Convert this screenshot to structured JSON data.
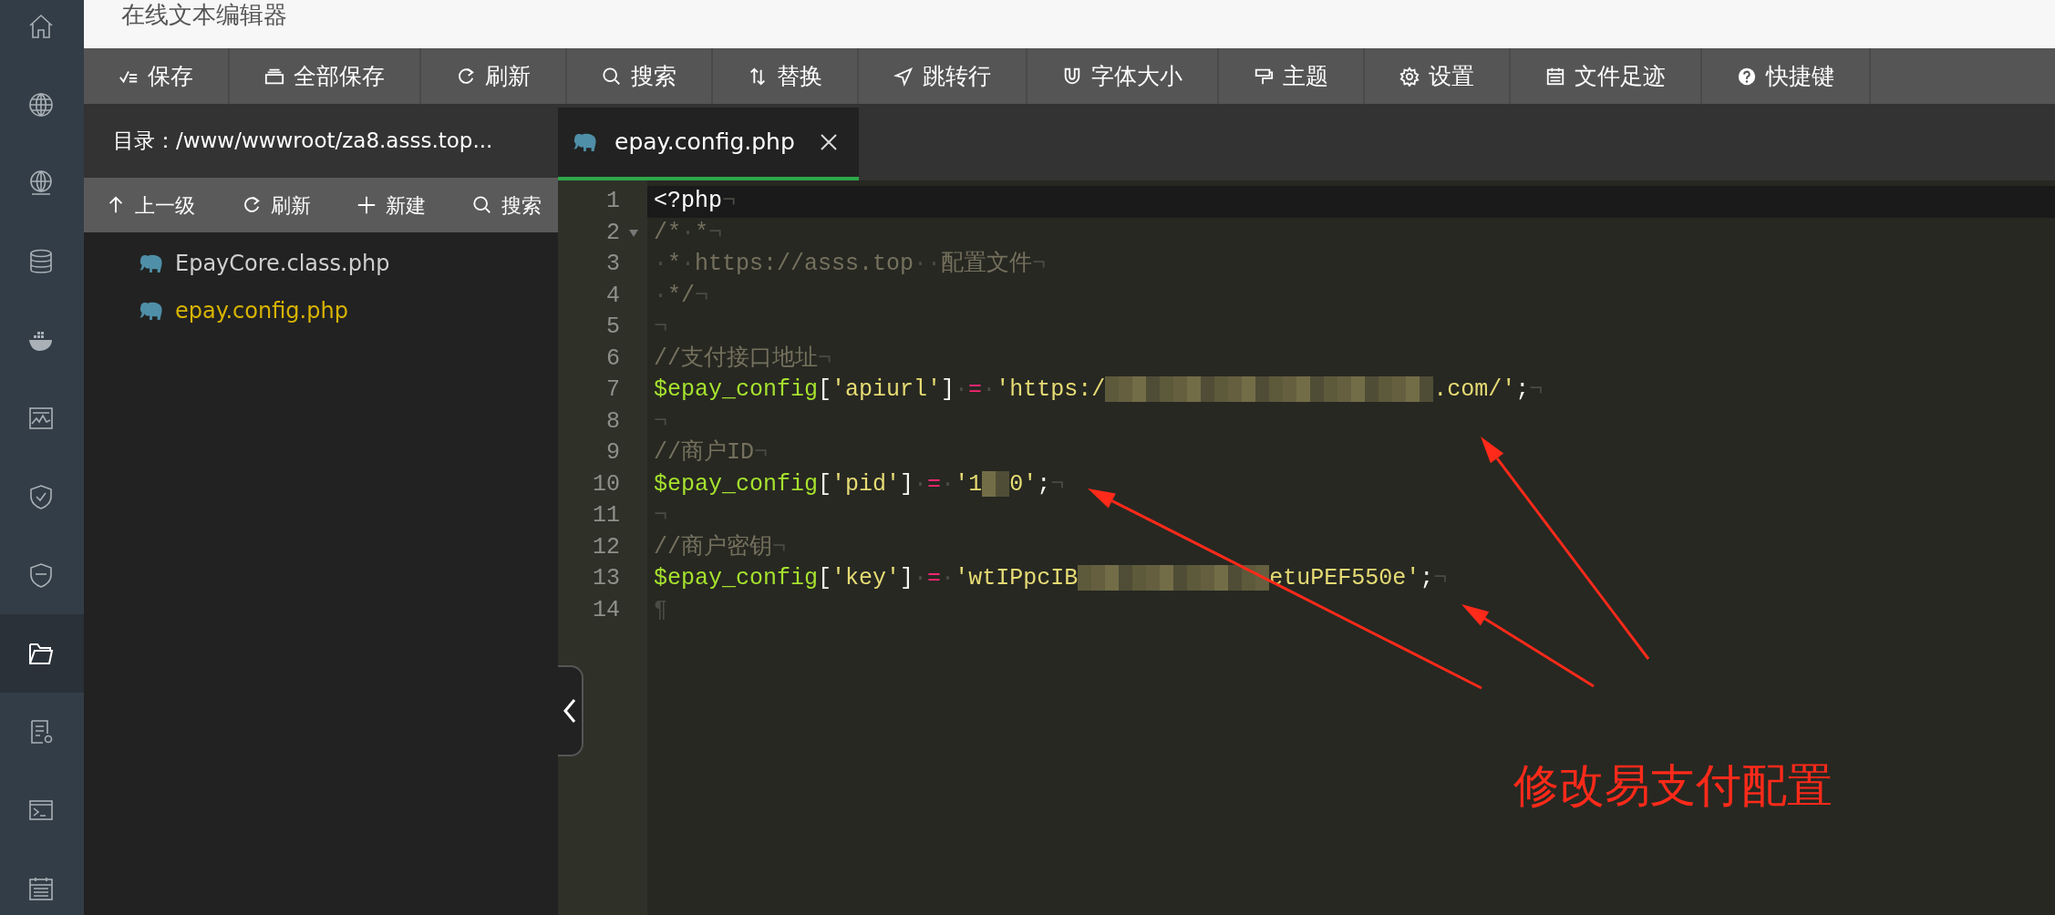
{
  "sidebar": {
    "items": [
      {
        "selected": false
      },
      {
        "selected": false
      },
      {
        "selected": false
      },
      {
        "selected": false
      },
      {
        "selected": false
      },
      {
        "selected": false
      },
      {
        "selected": false
      },
      {
        "selected": false
      },
      {
        "selected": true
      },
      {
        "selected": false
      },
      {
        "selected": false
      },
      {
        "selected": false
      }
    ]
  },
  "dialog": {
    "title": "在线文本编辑器"
  },
  "toolbar": {
    "buttons": [
      {
        "label": "保存"
      },
      {
        "label": "全部保存"
      },
      {
        "label": "刷新"
      },
      {
        "label": "搜索"
      },
      {
        "label": "替换"
      },
      {
        "label": "跳转行"
      },
      {
        "label": "字体大小"
      },
      {
        "label": "主题"
      },
      {
        "label": "设置"
      },
      {
        "label": "文件足迹"
      },
      {
        "label": "快捷键"
      }
    ]
  },
  "file_panel": {
    "directory": "目录：/www/wwwroot/za8.asss.top...",
    "actions": [
      {
        "label": "上一级"
      },
      {
        "label": "刷新"
      },
      {
        "label": "新建"
      },
      {
        "label": "搜索"
      }
    ],
    "files": [
      {
        "name": "EpayCore.class.php",
        "selected": false
      },
      {
        "name": "epay.config.php",
        "selected": true
      }
    ]
  },
  "editor": {
    "tabs": [
      {
        "label": "epay.config.php",
        "selected": true
      }
    ],
    "lines": [
      {
        "number": "1",
        "active": true,
        "foldable": false,
        "tokens": [
          {
            "kind": "plain",
            "text": "<?php"
          },
          {
            "kind": "invisible",
            "text": "¬"
          }
        ]
      },
      {
        "number": "2",
        "active": false,
        "foldable": true,
        "tokens": [
          {
            "kind": "comment",
            "text": "/*"
          },
          {
            "kind": "invisible",
            "text": "·"
          },
          {
            "kind": "comment",
            "text": "*"
          },
          {
            "kind": "invisible",
            "text": "¬"
          }
        ]
      },
      {
        "number": "3",
        "active": false,
        "foldable": false,
        "tokens": [
          {
            "kind": "invisible",
            "text": "·"
          },
          {
            "kind": "comment",
            "text": "*"
          },
          {
            "kind": "invisible",
            "text": "·"
          },
          {
            "kind": "comment",
            "text": "https://asss.top"
          },
          {
            "kind": "invisible",
            "text": "··"
          },
          {
            "kind": "comment",
            "text": "配置文件"
          },
          {
            "kind": "invisible",
            "text": "¬"
          }
        ]
      },
      {
        "number": "4",
        "active": false,
        "foldable": false,
        "tokens": [
          {
            "kind": "invisible",
            "text": "·"
          },
          {
            "kind": "comment",
            "text": "*/"
          },
          {
            "kind": "invisible",
            "text": "¬"
          }
        ]
      },
      {
        "number": "5",
        "active": false,
        "foldable": false,
        "tokens": [
          {
            "kind": "invisible",
            "text": "¬"
          }
        ]
      },
      {
        "number": "6",
        "active": false,
        "foldable": false,
        "tokens": [
          {
            "kind": "comment",
            "text": "//支付接口地址"
          },
          {
            "kind": "invisible",
            "text": "¬"
          }
        ]
      },
      {
        "number": "7",
        "active": false,
        "foldable": false,
        "tokens": [
          {
            "kind": "variable",
            "text": "$epay_config"
          },
          {
            "kind": "plain",
            "text": "["
          },
          {
            "kind": "string",
            "text": "'apiurl'"
          },
          {
            "kind": "plain",
            "text": "]"
          },
          {
            "kind": "invisible",
            "text": "·"
          },
          {
            "kind": "operator",
            "text": "="
          },
          {
            "kind": "invisible",
            "text": "·"
          },
          {
            "kind": "string",
            "text": "'https:/"
          },
          {
            "kind": "redacted"
          },
          {
            "kind": "redacted"
          },
          {
            "kind": "redacted"
          },
          {
            "kind": "redacted"
          },
          {
            "kind": "redacted"
          },
          {
            "kind": "redacted"
          },
          {
            "kind": "redacted"
          },
          {
            "kind": "redacted"
          },
          {
            "kind": "redacted"
          },
          {
            "kind": "redacted"
          },
          {
            "kind": "redacted"
          },
          {
            "kind": "redacted"
          },
          {
            "kind": "string",
            "text": ".com/'"
          },
          {
            "kind": "plain",
            "text": ";"
          },
          {
            "kind": "invisible",
            "text": "¬"
          }
        ]
      },
      {
        "number": "8",
        "active": false,
        "foldable": false,
        "tokens": [
          {
            "kind": "invisible",
            "text": "¬"
          }
        ]
      },
      {
        "number": "9",
        "active": false,
        "foldable": false,
        "tokens": [
          {
            "kind": "comment",
            "text": "//商户ID"
          },
          {
            "kind": "invisible",
            "text": "¬"
          }
        ]
      },
      {
        "number": "10",
        "active": false,
        "foldable": false,
        "tokens": [
          {
            "kind": "variable",
            "text": "$epay_config"
          },
          {
            "kind": "plain",
            "text": "["
          },
          {
            "kind": "string",
            "text": "'pid'"
          },
          {
            "kind": "plain",
            "text": "]"
          },
          {
            "kind": "invisible",
            "text": "·"
          },
          {
            "kind": "operator",
            "text": "="
          },
          {
            "kind": "invisible",
            "text": "·"
          },
          {
            "kind": "string",
            "text": "'1"
          },
          {
            "kind": "redacted"
          },
          {
            "kind": "string",
            "text": "0'"
          },
          {
            "kind": "plain",
            "text": ";"
          },
          {
            "kind": "invisible",
            "text": "¬"
          }
        ]
      },
      {
        "number": "11",
        "active": false,
        "foldable": false,
        "tokens": [
          {
            "kind": "invisible",
            "text": "¬"
          }
        ]
      },
      {
        "number": "12",
        "active": false,
        "foldable": false,
        "tokens": [
          {
            "kind": "comment",
            "text": "//商户密钥"
          },
          {
            "kind": "invisible",
            "text": "¬"
          }
        ]
      },
      {
        "number": "13",
        "active": false,
        "foldable": false,
        "tokens": [
          {
            "kind": "variable",
            "text": "$epay_config"
          },
          {
            "kind": "plain",
            "text": "["
          },
          {
            "kind": "string",
            "text": "'key'"
          },
          {
            "kind": "plain",
            "text": "]"
          },
          {
            "kind": "invisible",
            "text": "·"
          },
          {
            "kind": "operator",
            "text": "="
          },
          {
            "kind": "invisible",
            "text": "·"
          },
          {
            "kind": "string",
            "text": "'wtIPpcIB"
          },
          {
            "kind": "redacted"
          },
          {
            "kind": "redacted"
          },
          {
            "kind": "redacted"
          },
          {
            "kind": "redacted"
          },
          {
            "kind": "redacted"
          },
          {
            "kind": "redacted"
          },
          {
            "kind": "redacted"
          },
          {
            "kind": "string",
            "text": "etuPEF550e'"
          },
          {
            "kind": "plain",
            "text": ";"
          },
          {
            "kind": "invisible",
            "text": "¬"
          }
        ]
      },
      {
        "number": "14",
        "active": false,
        "foldable": false,
        "tokens": [
          {
            "kind": "invisible",
            "text": "¶"
          }
        ]
      }
    ]
  },
  "annotation": {
    "text": "修改易支付配置"
  }
}
